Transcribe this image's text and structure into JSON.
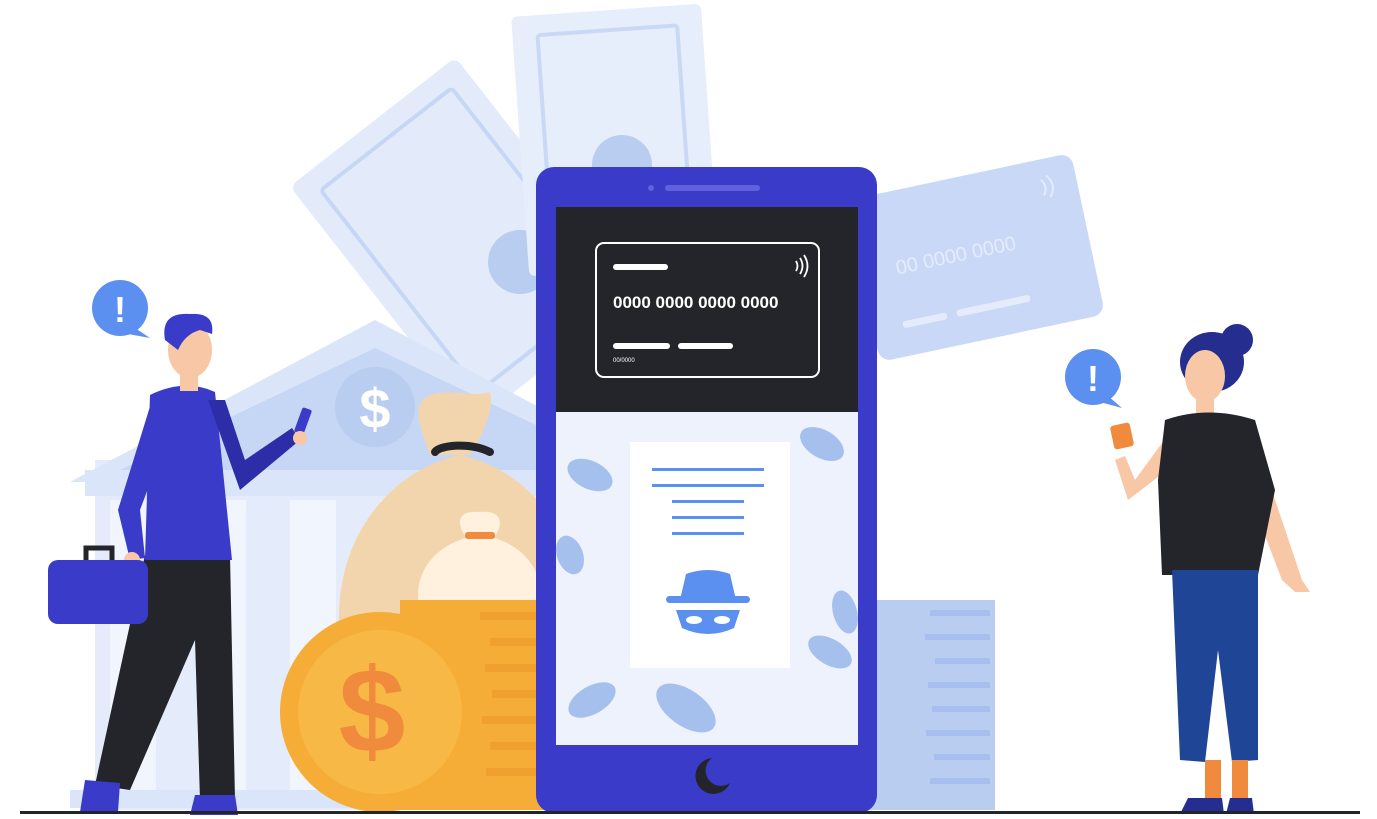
{
  "phone_card": {
    "number": "0000 0000 0000 0000",
    "expiry": "00/0000"
  },
  "background_card": {
    "number": "00 0000 0000"
  },
  "bank": {
    "symbol": "$"
  },
  "coin": {
    "symbol": "$"
  },
  "alerts": {
    "man_symbol": "!",
    "woman_symbol": "!"
  },
  "colors": {
    "primary_blue": "#3b3bc9",
    "screen_dark": "#24252b",
    "light_blue": "#b9cdf1",
    "coin_orange": "#f6ad38",
    "bag_beige": "#f2d5ad",
    "alert_blue": "#5b8ff0"
  },
  "icons": [
    "contactless-icon",
    "incognito-icon",
    "dollar-icon",
    "alert-icon"
  ]
}
